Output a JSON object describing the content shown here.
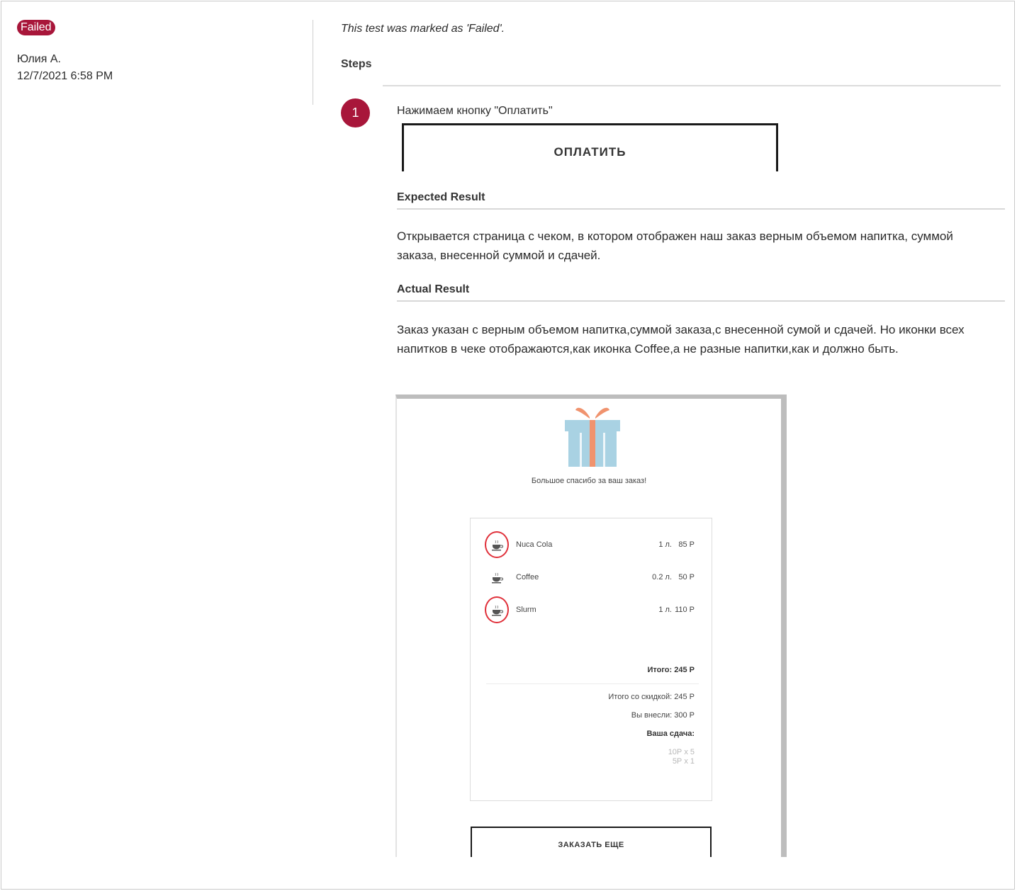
{
  "result": {
    "status": "Failed",
    "author": "Юлия А.",
    "timestamp": "12/7/2021 6:58 PM",
    "note": "This test was marked as 'Failed'."
  },
  "steps": {
    "heading": "Steps",
    "items": [
      {
        "number": "1",
        "action": "Нажимаем кнопку \"Оплатить\"",
        "action_screenshot_button": "ОПЛАТИТЬ",
        "expected_title": "Expected Result",
        "expected_text": "Открывается страница с чеком, в котором отображен наш заказ верным объемом напитка, суммой заказа, внесенной суммой и сдачей.",
        "actual_title": "Actual Result",
        "actual_text": "Заказ указан с верным объемом напитка,суммой заказа,с внесенной сумой и сдачей. Но иконки всех напитков в чеке отображаются,как иконка Coffee,а не разные напитки,как и должно быть."
      }
    ]
  },
  "receipt": {
    "thanks": "Большое спасибо за ваш заказ!",
    "items": [
      {
        "name": "Nuca Cola",
        "volume": "1 л.",
        "price": "85 Р",
        "icon": "coffee-cup-icon",
        "circled": true
      },
      {
        "name": "Coffee",
        "volume": "0.2 л.",
        "price": "50 Р",
        "icon": "coffee-cup-icon",
        "circled": false
      },
      {
        "name": "Slurm",
        "volume": "1 л.",
        "price": "110 Р",
        "icon": "coffee-cup-icon",
        "circled": true
      }
    ],
    "total": "Итого: 245 Р",
    "discount_total": "Итого со скидкой: 245 Р",
    "paid": "Вы внесли: 300 Р",
    "change_title": "Ваша сдача:",
    "change_lines": [
      "10Р x 5",
      "5Р x 1"
    ],
    "order_more": "ЗАКАЗАТЬ ЕЩЕ"
  },
  "colors": {
    "accent": "#a8163a",
    "highlight_circle": "#e0303a",
    "gift_box": "#a9d2e3",
    "gift_ribbon": "#f0936e"
  }
}
